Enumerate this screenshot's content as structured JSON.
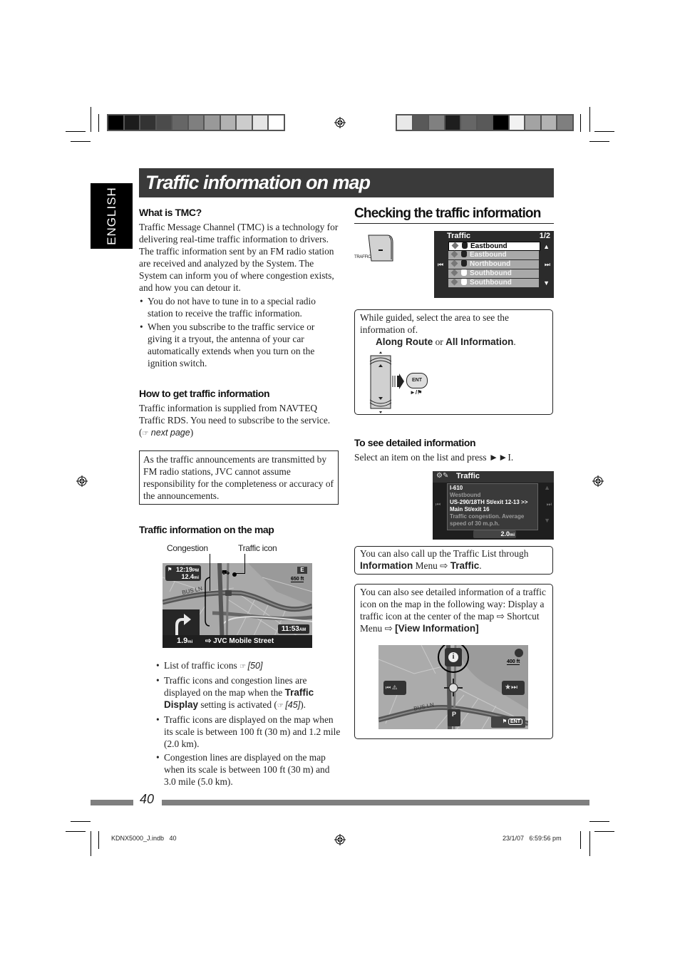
{
  "page": {
    "language_tab": "ENGLISH",
    "title": "Traffic information on map",
    "page_number": "40",
    "footer_file": "KDNX5000_J.indb   40",
    "footer_timestamp": "23/1/07   6:59:56 pm"
  },
  "color_bars": {
    "left": [
      "#000000",
      "#1c1c1c",
      "#333333",
      "#4b4b4b",
      "#666666",
      "#7f7f7f",
      "#999999",
      "#b2b2b2",
      "#cccccc",
      "#e5e5e5",
      "#ffffff"
    ],
    "right": [
      "#e8e8e8",
      "#595959",
      "#808080",
      "#1e1e1e",
      "#666666",
      "#595959",
      "#000000",
      "#f2f2f2",
      "#a3a3a3",
      "#b3b3b3",
      "#7f7f7f"
    ]
  },
  "left_column": {
    "what_is_tmc": {
      "heading": "What is TMC?",
      "body": "Traffic Message Channel (TMC) is a technology for delivering real-time traffic information to drivers. The traffic information sent by an FM radio station are received and analyzed by the System. The System can inform you of where congestion exists, and how you can detour it.",
      "bullets": [
        "You do not have to tune in to a special radio station to receive the traffic information.",
        "When you subscribe to the traffic service or giving it a tryout, the antenna of your car automatically extends when you turn on the ignition switch."
      ]
    },
    "how_to_get": {
      "heading": "How to get traffic information",
      "body": "Traffic information is supplied from NAVTEQ Traffic RDS. You need to subscribe to the service. (",
      "ref_icon": "☞",
      "ref_text": "next page",
      "body_end": ")"
    },
    "disclaimer": "As the traffic announcements are transmitted by FM radio stations, JVC cannot assume responsibility for the completeness or accuracy of the announcements.",
    "on_the_map": {
      "heading": "Traffic information on the map",
      "callout_congestion": "Congestion",
      "callout_traffic_icon": "Traffic icon",
      "map_screen": {
        "time": "12:19",
        "time_suffix": "PM",
        "distance": "12.4",
        "distance_unit": "mi",
        "compass": "E",
        "scale": "650 ft",
        "clock": "11:53",
        "clock_suffix": "AM",
        "turn_distance": "1.9",
        "turn_unit": "mi",
        "street": "JVC Mobile Street",
        "road_label": "BUS LN"
      },
      "bullets": [
        {
          "text": "List of traffic icons ",
          "ref": "[50]"
        },
        {
          "pre": "Traffic icons and congestion lines are displayed on the map when the ",
          "bold": "Traffic Display",
          "post": " setting is activated (",
          "ref": "[45]",
          "end": ")."
        },
        {
          "text": "Traffic icons are displayed on the map when its scale is between 100 ft (30 m) and 1.2 mile (2.0 km)."
        },
        {
          "text": "Congestion lines are displayed on the map when its scale is between 100 ft (30 m) and 3.0 mile (5.0 km)."
        }
      ]
    }
  },
  "right_column": {
    "heading": "Checking the traffic information",
    "traffic_button_label": "TRAFFIC",
    "traffic_list_screen": {
      "title": "Traffic",
      "page": "1/2",
      "rows": [
        {
          "label": "Eastbound",
          "selected": true,
          "shield": "dark"
        },
        {
          "label": "Eastbound",
          "selected": false,
          "shield": "dark"
        },
        {
          "label": "Northbound",
          "selected": false,
          "shield": "dark"
        },
        {
          "label": "Southbound",
          "selected": false,
          "shield": "light"
        },
        {
          "label": "Southbound",
          "selected": false,
          "shield": "light"
        }
      ]
    },
    "guided_box": {
      "text": "While guided, select the area to see the information of.",
      "option1": "Along Route",
      "or": " or ",
      "option2": "All Information",
      "period": ".",
      "ent_label": "ENT",
      "ent_sub": "►/⚑"
    },
    "detailed": {
      "heading": "To see detailed information",
      "body": "Select an item on the list and press ►►I.",
      "screen": {
        "title": "Traffic",
        "lines": [
          {
            "text": "I-610",
            "dim": false
          },
          {
            "text": "Westbound",
            "dim": true
          },
          {
            "text": "US-290/18TH St/exit 12-13 >>",
            "dim": false
          },
          {
            "text": "Main St/exit 16",
            "dim": false
          },
          {
            "text": "Traffic congestion. Average",
            "dim": true
          },
          {
            "text": "speed of 30 m.p.h.",
            "dim": true
          }
        ],
        "distance": "2.0",
        "distance_unit": "mi"
      }
    },
    "traffic_list_note": {
      "pre": "You can also call up the Traffic List through ",
      "bold1": "Information",
      "mid": " Menu ⇨ ",
      "bold2": "Traffic",
      "end": "."
    },
    "view_info_note": {
      "text": "You can also see detailed information of a traffic icon on the map in the following way: Display a traffic icon at the center of the map ⇨ Shortcut Menu ⇨ ",
      "bold": "[View Information]",
      "map": {
        "scale": "400 ft",
        "road_label": "BUS LN",
        "ent_label": "ENT"
      }
    }
  }
}
